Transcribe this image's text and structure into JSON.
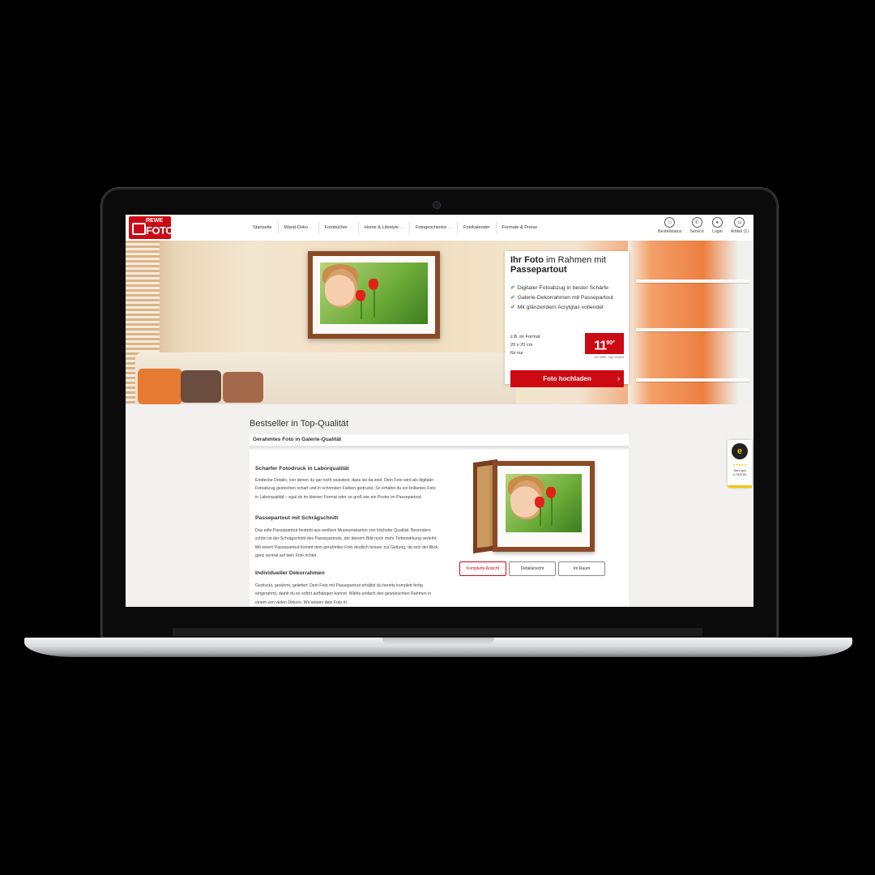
{
  "brand": {
    "top": "REWE",
    "bottom": "FOTO",
    "color": "#cc0a14"
  },
  "nav": [
    {
      "label": "Startseite",
      "caret": false
    },
    {
      "label": "Wand-Deko",
      "caret": true
    },
    {
      "label": "Fotobücher",
      "caret": true
    },
    {
      "label": "Home & Lifestyle",
      "caret": true
    },
    {
      "label": "Fotogeschenke",
      "caret": true
    },
    {
      "label": "Fotokalender",
      "caret": false
    },
    {
      "label": "Formate & Preise",
      "caret": false
    }
  ],
  "utility": [
    {
      "label": "Bestellstatus",
      "icon": "truck-icon"
    },
    {
      "label": "Service",
      "icon": "phone-icon"
    },
    {
      "label": "Login",
      "icon": "user-icon"
    },
    {
      "label": "Artikel (1)",
      "icon": "cart-icon"
    }
  ],
  "hero": {
    "title_bold": "Ihr Foto ",
    "title_mid": "im Rahmen mit",
    "title_last": "Passepartout",
    "features": [
      "Digitaler Fotoabzug in bester Schärfe",
      "Galerie-Dekorrahmen mit Passepartout",
      "Mit glänzendem Acrylglas vollendet"
    ],
    "format_line1": "z.B. im Format",
    "format_line2": "20 x 20 cm",
    "format_line3": "für nur",
    "price_main": "11",
    "price_cents": "90*",
    "price_note": "inkl. MwSt., zzgl. Versand",
    "cta": "Foto hochladen"
  },
  "content": {
    "section_title": "Bestseller in Top-Qualität",
    "tab": "Gerahmtes Foto in Galerie-Qualität",
    "blocks": [
      {
        "heading": "Scharfer Fotodruck in Laborqualität",
        "text": "Entdecke Details, von denen du gar nicht wusstest, dass sie da sind. Dein Foto wird als digitaler Fotoabzug gestochen scharf und in schönsten Farben gedruckt. So erhältst du ein brillantes Foto in Laborqualität – egal ob im kleinen Format oder so groß wie ein Poster im Passepartout."
      },
      {
        "heading": "Passepartout mit Schrägschnitt",
        "text": "Das edle Passepartout besteht aus weißem Museumskarton von höchster Qualität. Besonders schön ist der Schrägschnitt des Passepartouts, der deinem Bild noch mehr Tiefenwirkung verleiht. Mit einem Passepartout kommt dein gerahmtes Foto deutlich besser zur Geltung, da sich der Blick ganz zentral auf dein Foto richtet."
      },
      {
        "heading": "Individueller Dekorrahmen",
        "text": "Gedruckt, gerahmt, geliefert: Dein Foto mit Passepartout erhältst du bereits komplett fertig eingerahmt, damit du es sofort aufhängen kannst. Wähle einfach den gewünschten Rahmen in einem von vielen Dekors. Wir setzen dein Foto in"
      }
    ],
    "view_buttons": [
      "Komplette Ansicht",
      "Detailansicht",
      "Im Raum"
    ],
    "active_view": 0
  },
  "trust": {
    "letter": "e",
    "stars": "★★★★★",
    "label": "Sehr gut",
    "score": "4.74/5.00"
  }
}
